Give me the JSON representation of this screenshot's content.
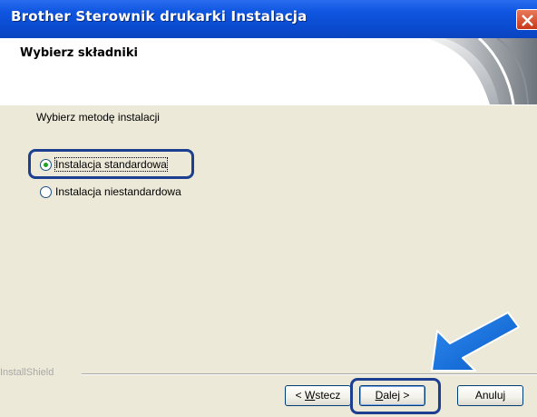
{
  "window": {
    "title": "Brother Sterownik drukarki Instalacja",
    "close_icon": "close-icon",
    "colors": {
      "titlebar": "#0a4bd0",
      "close": "#c8391a",
      "highlight": "#1d3f8f"
    }
  },
  "banner": {
    "title": "Wybierz składniki"
  },
  "content": {
    "prompt": "Wybierz metodę instalacji",
    "options": [
      {
        "label": "Instalacja standardowa",
        "checked": true
      },
      {
        "label": "Instalacja niestandardowa",
        "checked": false
      }
    ]
  },
  "footer": {
    "brand": "InstallShield",
    "back_button": {
      "prefix": "< ",
      "mnemonic": "W",
      "rest": "stecz"
    },
    "next_button": {
      "mnemonic": "D",
      "rest": "alej",
      "suffix": " >"
    },
    "cancel_button": {
      "label": "Anuluj"
    }
  }
}
